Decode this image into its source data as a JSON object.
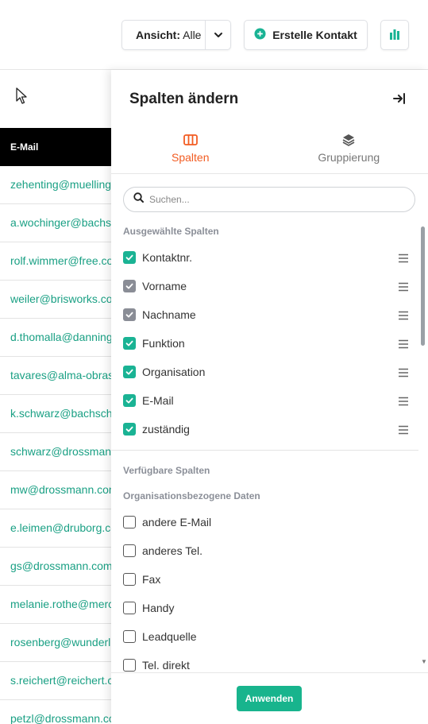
{
  "toolbar": {
    "view_label_bold": "Ansicht:",
    "view_value": "Alle",
    "create_label": "Erstelle Kontakt"
  },
  "table": {
    "email_header": "E-Mail",
    "emails": [
      "zehenting@muelling",
      "a.wochinger@bachs",
      "rolf.wimmer@free.co",
      "weiler@brisworks.co",
      "d.thomalla@danning",
      "tavares@alma-obras",
      "k.schwarz@bachsch",
      "schwarz@drossman",
      "mw@drossmann.con",
      "e.leimen@druborg.co",
      "gs@drossmann.com",
      "melanie.rothe@merc",
      "rosenberg@wunderl",
      "s.reichert@reichert.c",
      "petzl@drossmann.cc"
    ]
  },
  "panel": {
    "title": "Spalten ändern",
    "tabs": [
      {
        "label": "Spalten",
        "icon": "columns-icon",
        "active": true
      },
      {
        "label": "Gruppierung",
        "icon": "layers-icon",
        "active": false
      }
    ],
    "search_placeholder": "Suchen...",
    "selected_heading": "Ausgewählte Spalten",
    "selected": [
      {
        "label": "Kontaktnr.",
        "state": "checked"
      },
      {
        "label": "Vorname",
        "state": "checked-disabled"
      },
      {
        "label": "Nachname",
        "state": "checked-disabled"
      },
      {
        "label": "Funktion",
        "state": "checked"
      },
      {
        "label": "Organisation",
        "state": "checked"
      },
      {
        "label": "E-Mail",
        "state": "checked"
      },
      {
        "label": "zuständig",
        "state": "checked"
      }
    ],
    "available_heading": "Verfügbare Spalten",
    "org_heading": "Organisationsbezogene Daten",
    "available": [
      {
        "label": "andere E-Mail"
      },
      {
        "label": "anderes Tel."
      },
      {
        "label": "Fax"
      },
      {
        "label": "Handy"
      },
      {
        "label": "Leadquelle"
      },
      {
        "label": "Tel. direkt"
      }
    ],
    "apply_label": "Anwenden"
  },
  "colors": {
    "accent_green": "#1ab394",
    "link_green": "#1aa084",
    "tab_active_orange": "#f25c22",
    "disabled_check": "#8a8d96"
  }
}
